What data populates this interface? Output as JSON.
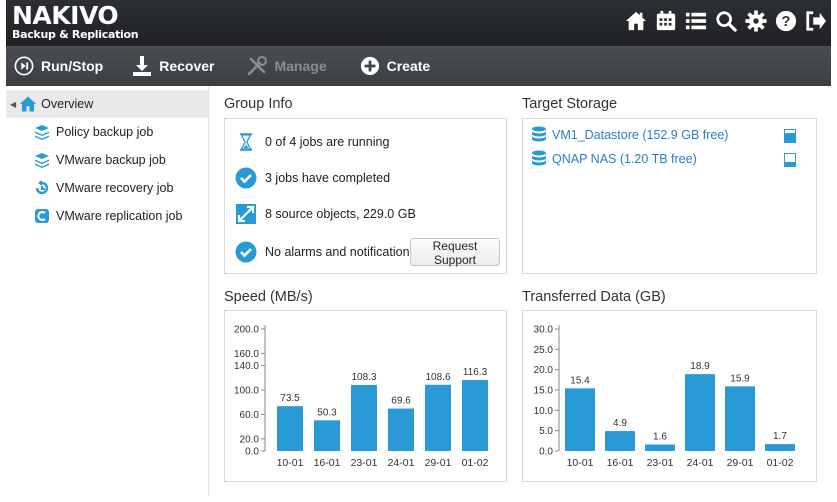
{
  "header": {
    "brand_name": "NAKIVO",
    "brand_sub": "Backup & Replication",
    "icons": [
      "home-icon",
      "calendar-icon",
      "list-icon",
      "search-icon",
      "gear-icon",
      "help-icon",
      "logout-icon"
    ]
  },
  "toolbar": {
    "run_stop_label": "Run/Stop",
    "recover_label": "Recover",
    "manage_label": "Manage",
    "create_label": "Create"
  },
  "sidebar": {
    "root_label": "Overview",
    "items": [
      {
        "label": "Policy backup job",
        "icon": "backup-job-icon"
      },
      {
        "label": "VMware backup job",
        "icon": "backup-job-icon"
      },
      {
        "label": "VMware recovery job",
        "icon": "recovery-job-icon"
      },
      {
        "label": "VMware replication job",
        "icon": "replication-job-icon"
      }
    ]
  },
  "group_info": {
    "title": "Group Info",
    "rows": [
      {
        "text": "0 of 4 jobs are running",
        "icon": "hourglass-icon"
      },
      {
        "text": "3 jobs have completed",
        "icon": "check-icon"
      },
      {
        "text": "8 source objects, 229.0 GB",
        "icon": "objects-icon"
      },
      {
        "text": "No alarms and notifications",
        "icon": "check-icon"
      }
    ],
    "request_support_label": "Request Support"
  },
  "target_storage": {
    "title": "Target Storage",
    "items": [
      {
        "label": "VM1_Datastore (152.9 GB free)",
        "fill": 0.75
      },
      {
        "label": "QNAP NAS (1.20 TB free)",
        "fill": 0.35
      }
    ]
  },
  "colors": {
    "accent": "#2a9ad6",
    "link": "#2a7fc9",
    "header_bg": "#2c2f33",
    "toolbar_bg": "#44474c"
  },
  "chart_data": [
    {
      "type": "bar",
      "title": "Speed (MB/s)",
      "categories": [
        "10-01",
        "16-01",
        "23-01",
        "24-01",
        "29-01",
        "01-02"
      ],
      "values": [
        73.5,
        50.3,
        108.3,
        69.6,
        108.6,
        116.3
      ],
      "value_labels": [
        "73.5",
        "50.3",
        "108.3",
        "69.6",
        "108.6",
        "116.3"
      ],
      "yticks": [
        0.0,
        20.0,
        60.0,
        100.0,
        140.0,
        160.0,
        200.0
      ],
      "ytick_labels": [
        "0.0",
        "20.0",
        "60.0",
        "100.0",
        "140.0",
        "160.0",
        "200.0"
      ],
      "ylim": [
        0,
        200
      ],
      "color": "#2a9ad6"
    },
    {
      "type": "bar",
      "title": "Transferred Data (GB)",
      "categories": [
        "10-01",
        "16-01",
        "23-01",
        "24-01",
        "29-01",
        "01-02"
      ],
      "values": [
        15.4,
        4.9,
        1.6,
        18.9,
        15.9,
        1.7
      ],
      "value_labels": [
        "15.4",
        "4.9",
        "1.6",
        "18.9",
        "15.9",
        "1.7"
      ],
      "yticks": [
        0.0,
        5.0,
        10.0,
        15.0,
        20.0,
        25.0,
        30.0
      ],
      "ytick_labels": [
        "0.0",
        "5.0",
        "10.0",
        "15.0",
        "20.0",
        "25.0",
        "30.0"
      ],
      "ylim": [
        0,
        30
      ],
      "color": "#2a9ad6"
    }
  ]
}
